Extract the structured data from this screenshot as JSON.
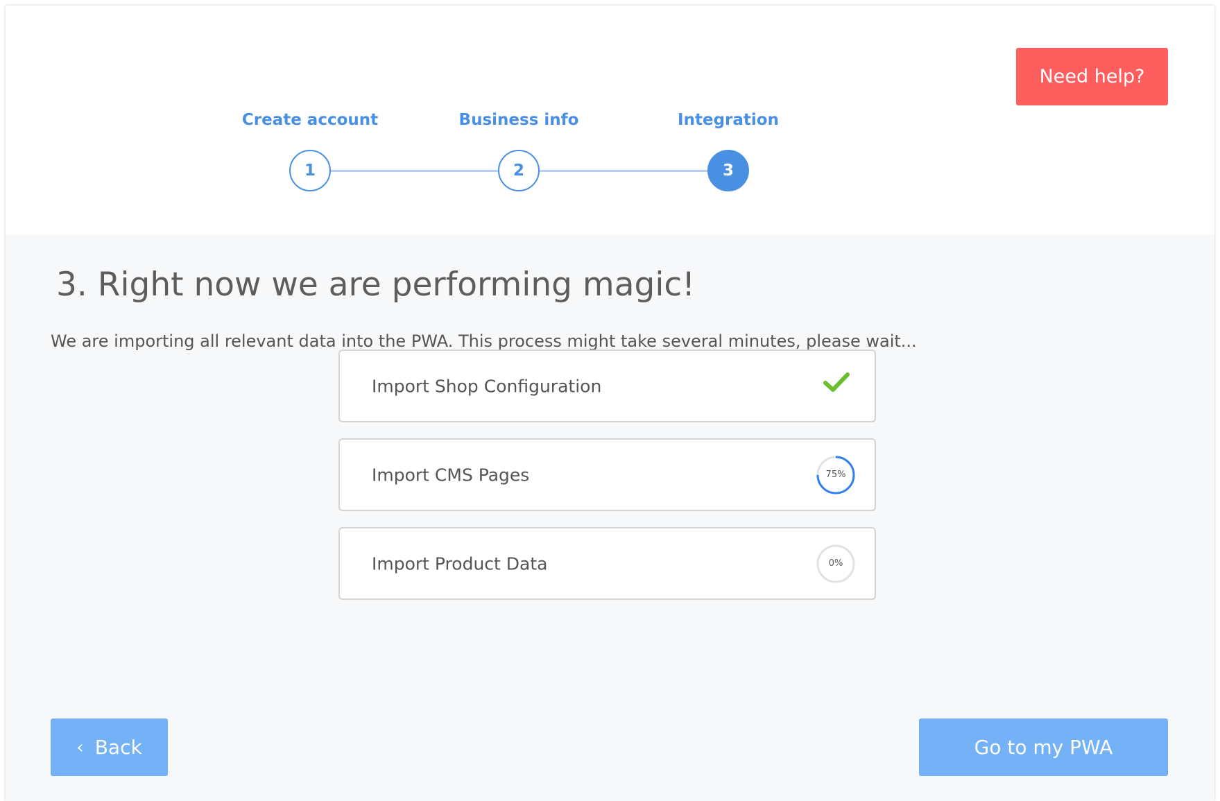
{
  "help_button": {
    "label": "Need help?"
  },
  "stepper": {
    "steps": [
      {
        "label": "Create account",
        "number": "1",
        "state": "done"
      },
      {
        "label": "Business info",
        "number": "2",
        "state": "done"
      },
      {
        "label": "Integration",
        "number": "3",
        "state": "active"
      }
    ]
  },
  "content": {
    "title": "3. Right now we are performing magic!",
    "description": "We are importing all relevant data into the PWA. This process might take several minutes, please wait..."
  },
  "tasks": [
    {
      "label": "Import Shop Configuration",
      "status": "complete",
      "icon": "check-icon"
    },
    {
      "label": "Import CMS Pages",
      "status": "in-progress",
      "progress": 0.75,
      "progress_text": "75%"
    },
    {
      "label": "Import Product Data",
      "status": "pending",
      "progress": 0,
      "progress_text": "0%"
    }
  ],
  "footer": {
    "back_label": "Back",
    "back_icon": "chevron-left-icon",
    "go_label": "Go to my PWA"
  },
  "colors": {
    "accent": "#4a90e2",
    "help": "#ff5e5e",
    "button": "#74b1f7",
    "success": "#6abf2e"
  }
}
